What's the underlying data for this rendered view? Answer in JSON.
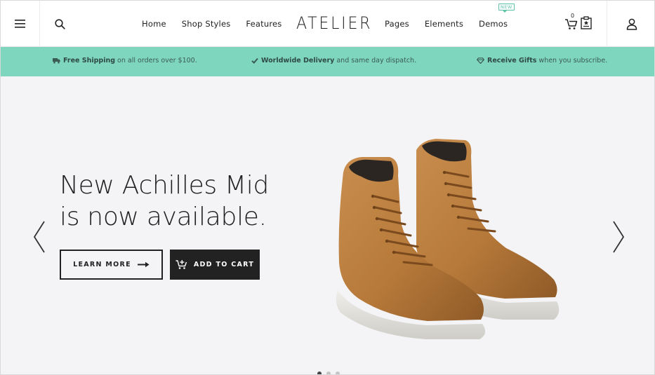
{
  "header": {
    "logo": "ATELIER",
    "nav_left": [
      {
        "label": "Home"
      },
      {
        "label": "Shop Styles"
      },
      {
        "label": "Features"
      }
    ],
    "nav_right": [
      {
        "label": "Pages"
      },
      {
        "label": "Elements"
      },
      {
        "label": "Demos",
        "badge": "NEW"
      }
    ],
    "cart_count": "0",
    "icons": {
      "menu": "hamburger-menu-icon",
      "search": "search-icon",
      "cart": "cart-icon",
      "wishlist": "wishlist-icon",
      "account": "user-icon"
    }
  },
  "promo": {
    "background": "#7fd6bf",
    "items": [
      {
        "icon": "truck-icon",
        "bold": "Free Shipping",
        "text": "on all orders over $100."
      },
      {
        "icon": "check-icon",
        "bold": "Worldwide Delivery",
        "text": "and same day dispatch."
      },
      {
        "icon": "diamond-icon",
        "bold": "Receive Gifts",
        "text": "when you subscribe."
      }
    ]
  },
  "hero": {
    "headline_line1": "New Achilles Mid",
    "headline_line2": "is now available.",
    "learn_more": "LEARN MORE",
    "add_to_cart": "ADD TO CART",
    "slide_count": 3,
    "active_slide": 1
  }
}
